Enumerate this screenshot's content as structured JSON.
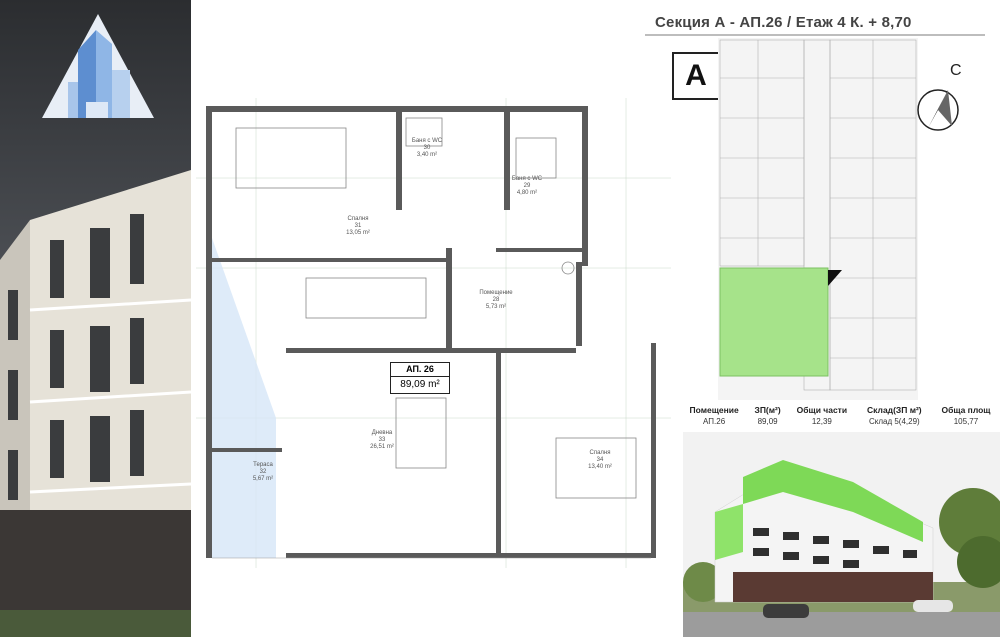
{
  "header": {
    "title": "Секция А - АП.26 / Етаж 4 К. + 8,70",
    "section_letter": "А",
    "compass_label": "С"
  },
  "apartment": {
    "name": "АП. 26",
    "area": "89,09 m²"
  },
  "rooms": [
    {
      "name": "Спалня",
      "num": "31",
      "area": "13,05 m²"
    },
    {
      "name": "Баня с WC",
      "num": "30",
      "area": "3,40 m²"
    },
    {
      "name": "Баня с WC",
      "num": "29",
      "area": "4,80 m²"
    },
    {
      "name": "Помещение",
      "num": "28",
      "area": "5,73 m²"
    },
    {
      "name": "Дневна",
      "num": "33",
      "area": "26,51 m²"
    },
    {
      "name": "Спалня",
      "num": "34",
      "area": "13,40 m²"
    },
    {
      "name": "Тераса",
      "num": "32",
      "area": "5,67 m²"
    }
  ],
  "table": {
    "headers": [
      "Помещение",
      "ЗП(м²)",
      "Общи части",
      "Склад(ЗП м²)",
      "Обща площ"
    ],
    "row": [
      "АП.26",
      "89,09",
      "12,39",
      "Склад 5(4,29)",
      "105,77"
    ]
  },
  "colors": {
    "highlight_green": "#a6e38a",
    "logo_blue": "#6b9bd2",
    "dark_panel": "#2b2d30"
  }
}
